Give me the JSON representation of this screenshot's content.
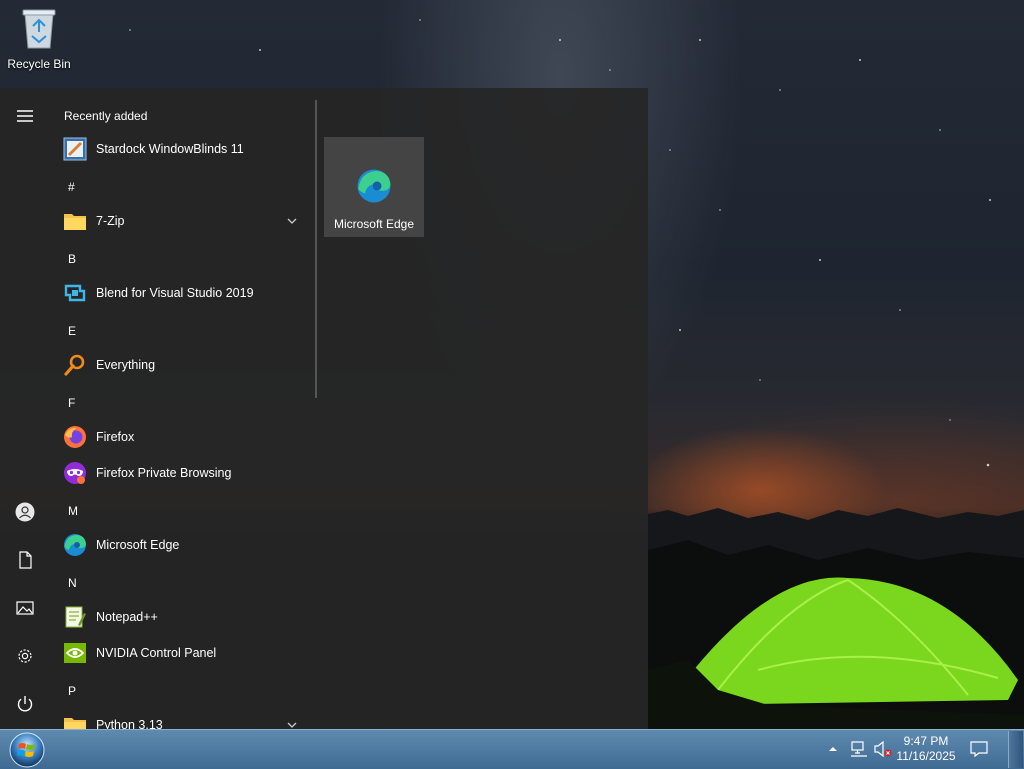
{
  "desktop": {
    "icons": [
      {
        "label": "Recycle Bin",
        "icon": "recycle-bin-icon"
      }
    ]
  },
  "start_menu": {
    "recently_added_heading": "Recently added",
    "recent_apps": [
      {
        "label": "Stardock WindowBlinds 11",
        "icon": "windowblinds-icon"
      }
    ],
    "sections": [
      {
        "letter": "#",
        "apps": [
          {
            "label": "7-Zip",
            "icon": "folder-icon",
            "expandable": true
          }
        ]
      },
      {
        "letter": "B",
        "apps": [
          {
            "label": "Blend for Visual Studio 2019",
            "icon": "blend-icon"
          }
        ]
      },
      {
        "letter": "E",
        "apps": [
          {
            "label": "Everything",
            "icon": "everything-search-icon"
          }
        ]
      },
      {
        "letter": "F",
        "apps": [
          {
            "label": "Firefox",
            "icon": "firefox-icon"
          },
          {
            "label": "Firefox Private Browsing",
            "icon": "firefox-private-icon"
          }
        ]
      },
      {
        "letter": "M",
        "apps": [
          {
            "label": "Microsoft Edge",
            "icon": "edge-icon"
          }
        ]
      },
      {
        "letter": "N",
        "apps": [
          {
            "label": "Notepad++",
            "icon": "notepadpp-icon"
          },
          {
            "label": "NVIDIA Control Panel",
            "icon": "nvidia-icon"
          }
        ]
      },
      {
        "letter": "P",
        "apps": [
          {
            "label": "Python 3.13",
            "icon": "folder-icon",
            "expandable": true
          }
        ]
      }
    ],
    "rail": [
      {
        "name": "menu",
        "icon": "hamburger-icon"
      },
      {
        "name": "user",
        "icon": "user-icon"
      },
      {
        "name": "documents",
        "icon": "document-icon"
      },
      {
        "name": "pictures",
        "icon": "pictures-icon"
      },
      {
        "name": "settings",
        "icon": "gear-icon"
      },
      {
        "name": "power",
        "icon": "power-icon"
      }
    ],
    "tiles": [
      {
        "label": "Microsoft Edge",
        "icon": "edge-icon"
      }
    ]
  },
  "taskbar": {
    "start_button_icon": "windows-orb-icon",
    "tray_icons": [
      "chevron-up-icon",
      "network-icon",
      "volume-muted-icon",
      "notification-icon"
    ],
    "clock": {
      "time": "9:47 PM",
      "date": "11/16/2025"
    }
  },
  "colors": {
    "start_menu_bg": "#262626",
    "tile_bg": "#444444",
    "taskbar_top": "#5f8ab0",
    "taskbar_bottom": "#3f6a92"
  }
}
